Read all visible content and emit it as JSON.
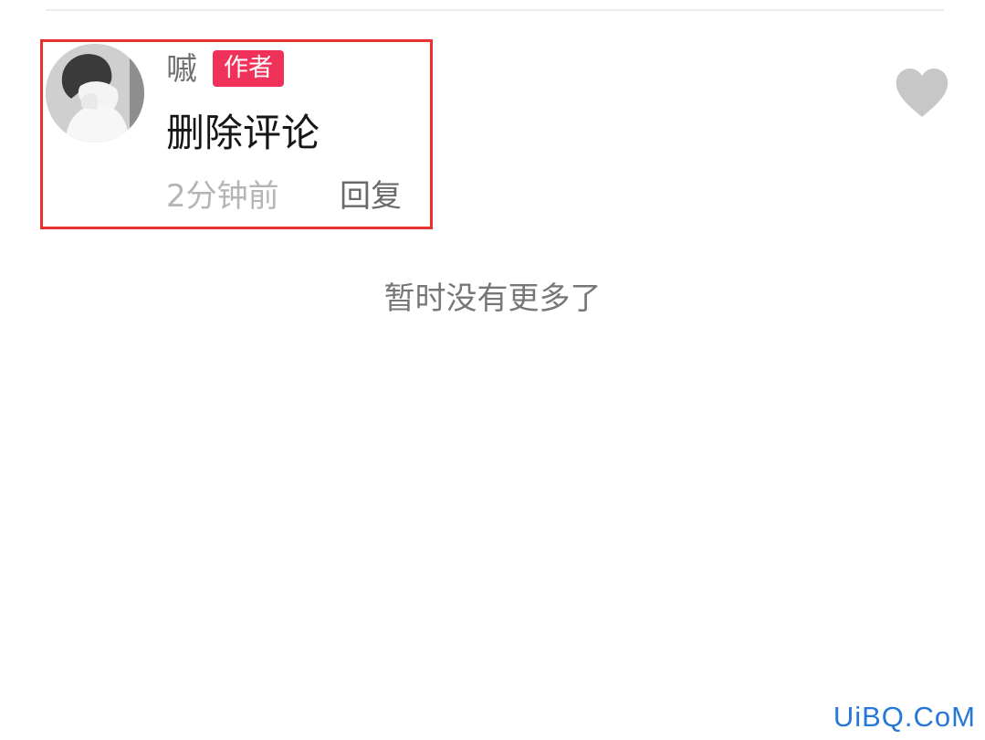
{
  "comment": {
    "username": "嘁",
    "author_badge": "作者",
    "text": "删除评论",
    "timestamp": "2分钟前",
    "reply_label": "回复",
    "badge_color": "#f0325a",
    "highlight_color": "#e8322f"
  },
  "like": {
    "icon": "heart-icon"
  },
  "footer": {
    "no_more_text": "暂时没有更多了"
  },
  "watermark": {
    "text": "UiBQ.CoM"
  }
}
